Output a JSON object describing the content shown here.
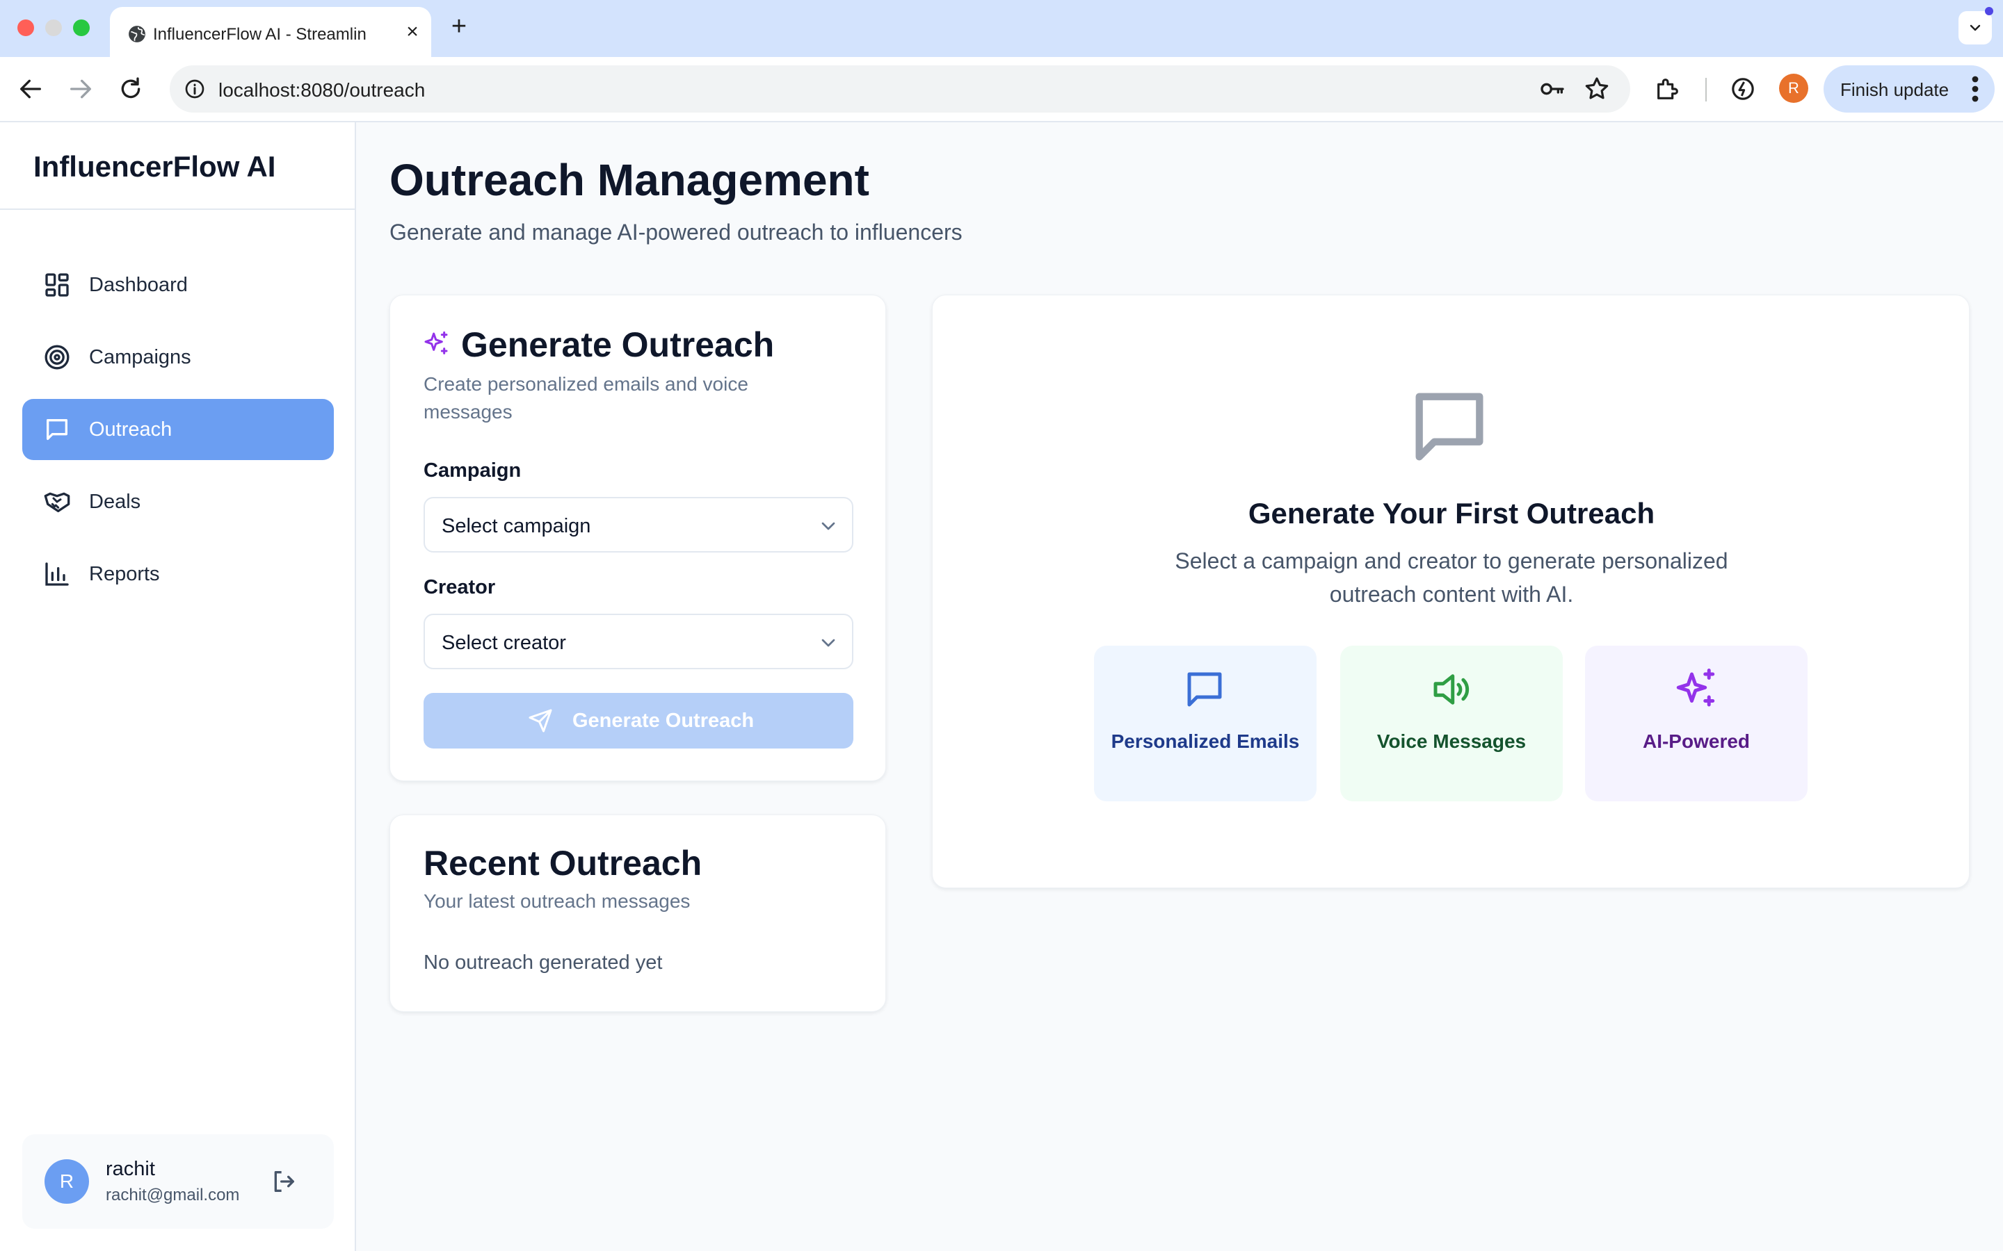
{
  "browser": {
    "tab_title": "InfluencerFlow AI - Streamlin",
    "new_tab": "+",
    "tab_close": "×",
    "url": "localhost:8080/outreach",
    "profile_initial": "R",
    "finish_update": "Finish update"
  },
  "sidebar": {
    "brand": "InfluencerFlow AI",
    "items": [
      {
        "label": "Dashboard",
        "icon": "dashboard-icon"
      },
      {
        "label": "Campaigns",
        "icon": "target-icon"
      },
      {
        "label": "Outreach",
        "icon": "message-icon",
        "active": true
      },
      {
        "label": "Deals",
        "icon": "handshake-icon"
      },
      {
        "label": "Reports",
        "icon": "bar-chart-icon"
      }
    ],
    "user": {
      "initial": "R",
      "name": "rachit",
      "email": "rachit@gmail.com"
    }
  },
  "main": {
    "title": "Outreach Management",
    "subtitle": "Generate and manage AI-powered outreach to influencers",
    "generate": {
      "title": "Generate Outreach",
      "description": "Create personalized emails and voice messages",
      "campaign_label": "Campaign",
      "campaign_value": "Select campaign",
      "creator_label": "Creator",
      "creator_value": "Select creator",
      "button_label": "Generate Outreach"
    },
    "recent": {
      "title": "Recent Outreach",
      "subtitle": "Your latest outreach messages",
      "empty": "No outreach generated yet"
    },
    "hero": {
      "title": "Generate Your First Outreach",
      "description": "Select a campaign and creator to generate personalized outreach content with AI.",
      "features": [
        {
          "label": "Personalized Emails",
          "icon": "message-icon",
          "color": "#3b6fd6"
        },
        {
          "label": "Voice Messages",
          "icon": "speaker-icon",
          "color": "#2f9e44"
        },
        {
          "label": "AI-Powered",
          "icon": "sparkles-icon",
          "color": "#9333ea"
        }
      ]
    }
  },
  "colors": {
    "primary": "#6b9ef2",
    "button_disabled": "#b5cff8",
    "browser_tabbar": "#d3e3fd"
  }
}
